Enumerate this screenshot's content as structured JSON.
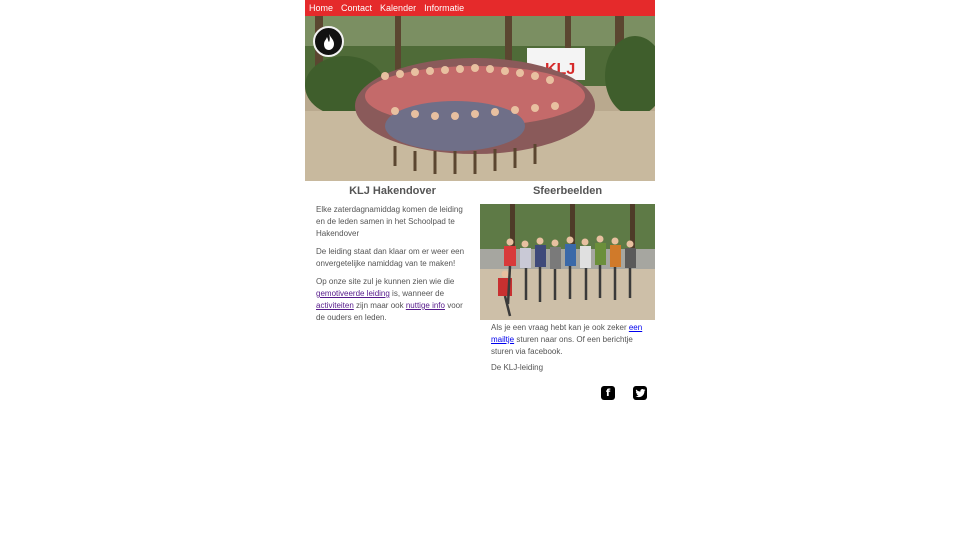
{
  "nav": {
    "items": [
      "Home",
      "Contact",
      "Kalender",
      "Informatie"
    ]
  },
  "hero": {
    "logo_icon": "flame-icon"
  },
  "left": {
    "title": "KLJ Hakendover",
    "p1": "Elke zaterdagnamiddag komen de leiding en de leden samen in het Schoolpad te Hakendover",
    "p2": "De leiding staat dan klaar om er weer een onvergetelijke namiddag van te maken!",
    "p3_a": "Op onze site zul je kunnen zien wie die ",
    "p3_link1": "gemotiveerde leiding",
    "p3_b": " is, wanneer de ",
    "p3_link2": "activiteiten",
    "p3_c": " zijn maar ook ",
    "p3_link3": "nuttige info",
    "p3_d": " voor de ouders en leden."
  },
  "right": {
    "title": "Sfeerbeelden",
    "p1_a": "Als je een vraag hebt kan je ook zeker ",
    "p1_link": "een mailtje",
    "p1_b": " sturen naar ons. Of een berichtje sturen via facebook.",
    "signature": "De KLJ-leiding"
  },
  "social": {
    "facebook_icon": "f",
    "twitter_icon": "t"
  },
  "colors": {
    "nav_bg": "#e52a2b"
  }
}
